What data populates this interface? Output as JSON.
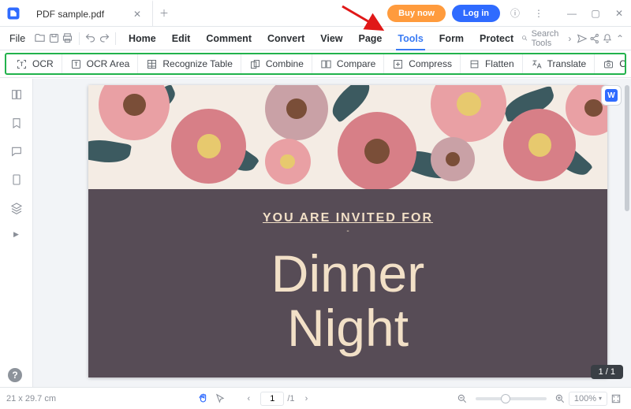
{
  "title_tab": {
    "label": "PDF sample.pdf"
  },
  "header": {
    "buy_label": "Buy now",
    "login_label": "Log in"
  },
  "menu": {
    "file": "File",
    "items": [
      "Home",
      "Edit",
      "Comment",
      "Convert",
      "View",
      "Page",
      "Tools",
      "Form",
      "Protect"
    ],
    "active_index": 6,
    "search_placeholder": "Search Tools"
  },
  "ribbon": {
    "tools": [
      {
        "icon": "ocr",
        "label": "OCR"
      },
      {
        "icon": "ocr-area",
        "label": "OCR Area"
      },
      {
        "icon": "table",
        "label": "Recognize Table"
      },
      {
        "icon": "combine",
        "label": "Combine"
      },
      {
        "icon": "compare",
        "label": "Compare"
      },
      {
        "icon": "compress",
        "label": "Compress"
      },
      {
        "icon": "flatten",
        "label": "Flatten"
      },
      {
        "icon": "translate",
        "label": "Translate"
      },
      {
        "icon": "capture",
        "label": "Capture",
        "dropdown": true
      }
    ]
  },
  "document": {
    "invite_small": "YOU ARE INVITED FOR",
    "invite_line1": "Dinner",
    "invite_line2": "Night"
  },
  "page_indicator": "1 / 1",
  "status": {
    "dimensions": "21 x 29.7 cm",
    "page_current": "1",
    "page_total": "/1",
    "zoom": "100%"
  }
}
